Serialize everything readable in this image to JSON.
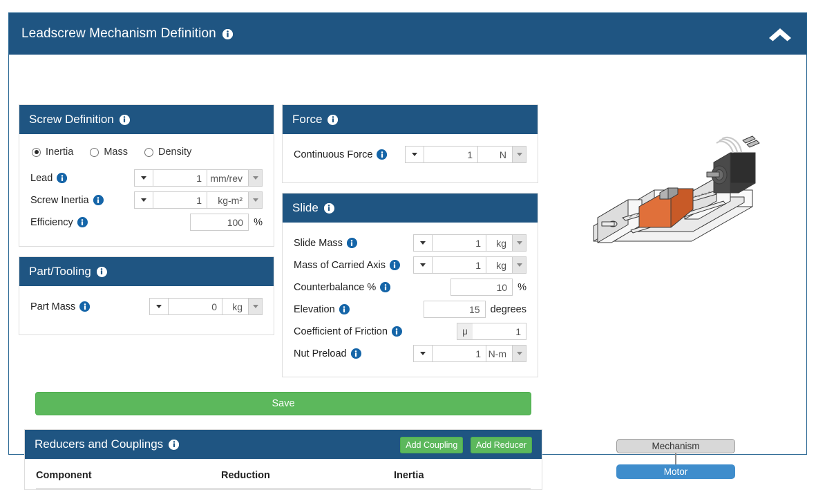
{
  "window": {
    "title": "Leadscrew Mechanism Definition",
    "info_icon": "info-icon",
    "collapse_icon": "chevron-up-icon",
    "header_color": "#1f5582"
  },
  "screw_definition": {
    "title": "Screw Definition",
    "mode_options": [
      {
        "label": "Inertia",
        "selected": true
      },
      {
        "label": "Mass",
        "selected": false
      },
      {
        "label": "Density",
        "selected": false
      }
    ],
    "fields": [
      {
        "label": "Lead",
        "value": "1",
        "unit": "mm/rev",
        "has_picker": true,
        "has_unit_select": true
      },
      {
        "label": "Screw Inertia",
        "value": "1",
        "unit": "kg-m²",
        "has_picker": true,
        "has_unit_select": true
      },
      {
        "label": "Efficiency",
        "value": "100",
        "suffix": "%",
        "has_picker": false,
        "has_unit_select": false
      }
    ]
  },
  "part_tooling": {
    "title": "Part/Tooling",
    "fields": [
      {
        "label": "Part Mass",
        "value": "0",
        "unit": "kg",
        "has_picker": true,
        "has_unit_select": true
      }
    ]
  },
  "force": {
    "title": "Force",
    "fields": [
      {
        "label": "Continuous Force",
        "value": "1",
        "unit": "N",
        "has_picker": true,
        "has_unit_select": true
      }
    ]
  },
  "slide": {
    "title": "Slide",
    "fields": [
      {
        "label": "Slide Mass",
        "value": "1",
        "unit": "kg",
        "has_picker": true,
        "has_unit_select": true
      },
      {
        "label": "Mass of Carried Axis",
        "value": "1",
        "unit": "kg",
        "has_picker": true,
        "has_unit_select": true
      },
      {
        "label": "Counterbalance %",
        "value": "10",
        "suffix": "%",
        "has_picker": false,
        "has_unit_select": false
      },
      {
        "label": "Elevation",
        "value": "15",
        "suffix": "degrees",
        "has_picker": false,
        "has_unit_select": false
      },
      {
        "label": "Coefficient of Friction",
        "value": "1",
        "prefix": "μ",
        "has_picker": false,
        "has_unit_select": false
      },
      {
        "label": "Nut Preload",
        "value": "1",
        "unit": "N-m",
        "has_picker": true,
        "has_unit_select": true
      }
    ]
  },
  "save_button": {
    "label": "Save",
    "color": "#5cb85c"
  },
  "reducers": {
    "title": "Reducers and Couplings",
    "add_coupling_label": "Add Coupling",
    "add_reducer_label": "Add Reducer",
    "columns": [
      "Component",
      "Reduction",
      "Inertia"
    ],
    "rows": []
  },
  "diagram": {
    "illustration": "leadscrew-linear-stage-illustration",
    "tree": [
      {
        "label": "Mechanism",
        "type": "mechanism"
      },
      {
        "label": "Motor",
        "type": "motor"
      }
    ]
  }
}
